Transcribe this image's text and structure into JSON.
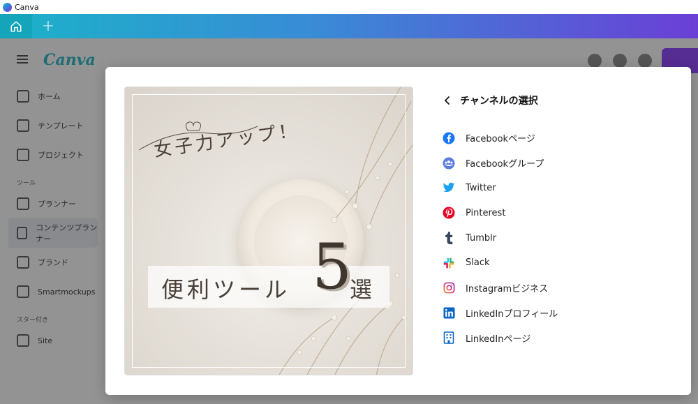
{
  "window": {
    "app_name": "Canva"
  },
  "tabbar": {
    "add_label": "+"
  },
  "background": {
    "logo": "Canva",
    "nav": [
      "ホーム",
      "テンプレート",
      "プロジェクト",
      "プランナー",
      "コンテンツプランナー",
      "ブランド",
      "Smartmockups",
      "Site"
    ],
    "sections": [
      "ツール",
      "スター付き"
    ]
  },
  "preview": {
    "headline": "女子力アップ！",
    "band_text": "便利ツール",
    "number": "5",
    "suffix": "選"
  },
  "panel": {
    "title": "チャンネルの選択",
    "channels": [
      {
        "label": "Facebookページ",
        "icon": "facebook-icon",
        "color": "#1877f2"
      },
      {
        "label": "Facebookグループ",
        "icon": "facebook-group-icon",
        "color": "#5b7ddc"
      },
      {
        "label": "Twitter",
        "icon": "twitter-icon",
        "color": "#1da1f2"
      },
      {
        "label": "Pinterest",
        "icon": "pinterest-icon",
        "color": "#e60023"
      },
      {
        "label": "Tumblr",
        "icon": "tumblr-icon",
        "color": "#36465d"
      },
      {
        "label": "Slack",
        "icon": "slack-icon",
        "color": "#4a154b"
      },
      {
        "label": "Instagramビジネス",
        "icon": "instagram-icon",
        "color": "#e1306c"
      },
      {
        "label": "LinkedInプロフィール",
        "icon": "linkedin-icon",
        "color": "#0a66c2"
      },
      {
        "label": "LinkedInページ",
        "icon": "linkedin-page-icon",
        "color": "#0a66c2"
      }
    ]
  }
}
